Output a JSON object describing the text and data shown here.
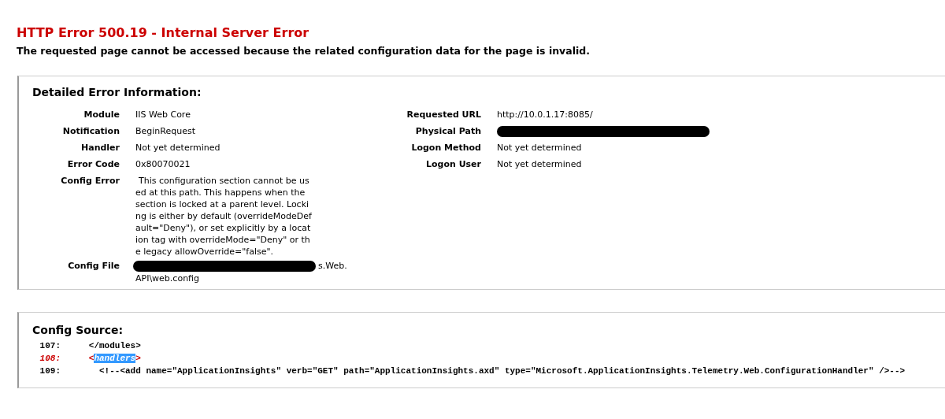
{
  "title": "HTTP Error 500.19 - Internal Server Error",
  "subtitle": "The requested page cannot be accessed because the related configuration data for the page is invalid.",
  "detail": {
    "heading": "Detailed Error Information:",
    "left": [
      {
        "label": "Module",
        "value": "IIS Web Core"
      },
      {
        "label": "Notification",
        "value": "BeginRequest"
      },
      {
        "label": "Handler",
        "value": "Not yet determined"
      },
      {
        "label": "Error Code",
        "value": "0x80070021"
      },
      {
        "label": "Config Error",
        "value": "This configuration section cannot be used at this path. This happens when the section is locked at a parent level. Locking is either by default (overrideModeDefault=\"Deny\"), or set explicitly by a location tag with overrideMode=\"Deny\" or the legacy allowOverride=\"false\"."
      },
      {
        "label": "Config File",
        "value": "s.Web. API\\web.config",
        "redacted": true
      }
    ],
    "right": [
      {
        "label": "Requested URL",
        "value": "http://10.0.1.17:8085/"
      },
      {
        "label": "Physical Path",
        "redacted": true
      },
      {
        "label": "Logon Method",
        "value": "Not yet determined"
      },
      {
        "label": "Logon User",
        "value": "Not yet determined"
      }
    ]
  },
  "source": {
    "heading": "Config Source:",
    "lines": [
      {
        "number": "107:",
        "error": false,
        "segments": [
          {
            "text": "   </modules>",
            "selected": false
          }
        ]
      },
      {
        "number": "108:",
        "error": true,
        "segments": [
          {
            "text": "   <",
            "selected": false
          },
          {
            "text": "handlers",
            "selected": true
          },
          {
            "text": ">",
            "selected": false
          }
        ]
      },
      {
        "number": "109:",
        "error": false,
        "segments": [
          {
            "text": "     <!--<add name=\"ApplicationInsights\" verb=\"GET\" path=\"ApplicationInsights.axd\" type=\"Microsoft.ApplicationInsights.Telemetry.Web.ConfigurationHandler\" />-->",
            "selected": false
          }
        ]
      }
    ]
  }
}
